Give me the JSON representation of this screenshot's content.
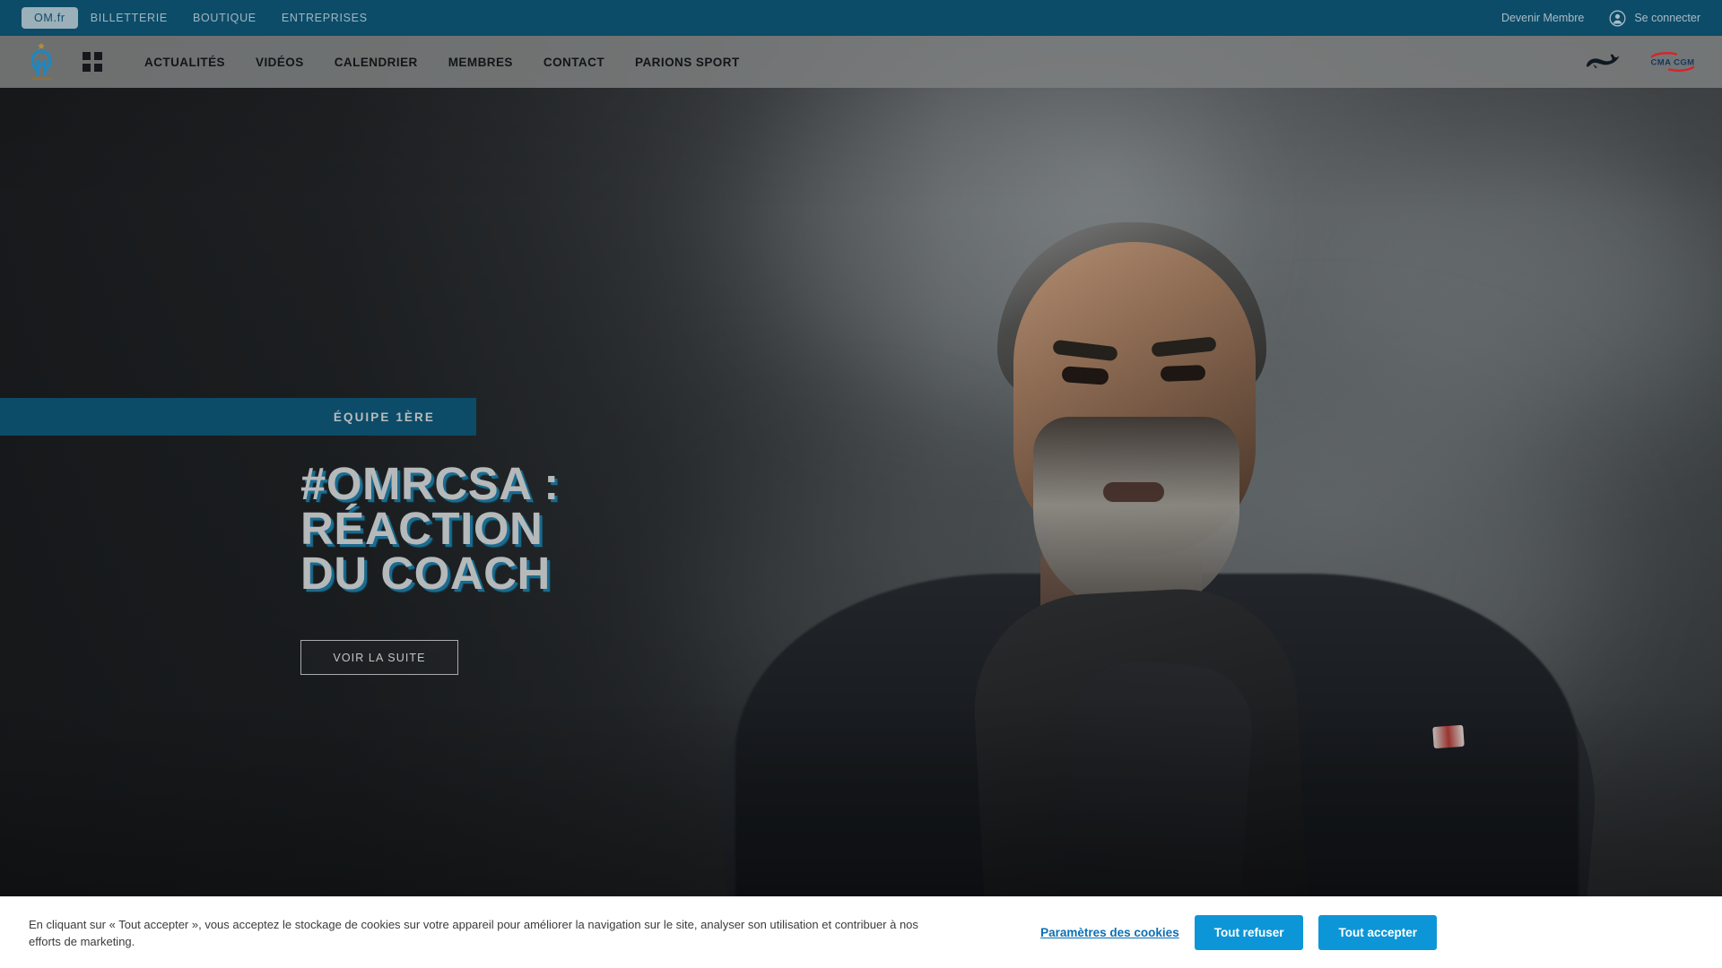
{
  "topbar": {
    "links": [
      {
        "label": "OM.fr",
        "active": true
      },
      {
        "label": "BILLETTERIE",
        "active": false
      },
      {
        "label": "BOUTIQUE",
        "active": false
      },
      {
        "label": "ENTREPRISES",
        "active": false
      }
    ],
    "member_label": "Devenir Membre",
    "signin_label": "Se connecter",
    "signin_icon": "user-avatar-icon",
    "background_color": "#0d4c68"
  },
  "mainnav": {
    "logo_alt": "Olympique de Marseille",
    "grid_icon": "grid-menu-icon",
    "items": [
      {
        "label": "ACTUALITÉS"
      },
      {
        "label": "VIDÉOS"
      },
      {
        "label": "CALENDRIER"
      },
      {
        "label": "MEMBRES"
      },
      {
        "label": "CONTACT"
      },
      {
        "label": "PARIONS SPORT"
      }
    ],
    "sponsors": [
      {
        "name": "puma-logo"
      },
      {
        "name": "cma-cgm-logo",
        "label": "CMA CGM"
      }
    ],
    "background_color": "#7d7f7f"
  },
  "hero": {
    "category": "ÉQUIPE 1ÈRE",
    "title_line1": "#OMRCSA :",
    "title_line2": "RÉACTION",
    "title_line3": "DU COACH",
    "cta_label": "VOIR LA SUITE",
    "badge_color": "#0c4c68",
    "title_shadow_color": "#1a6b8f",
    "image_alt": "Coach on the sideline"
  },
  "cookie_banner": {
    "text": "En cliquant sur « Tout accepter », vous acceptez le stockage de cookies sur votre appareil pour améliorer la navigation sur le site, analyser son utilisation et contribuer à nos efforts de marketing.",
    "settings_label": "Paramètres des cookies",
    "reject_label": "Tout refuser",
    "accept_label": "Tout accepter",
    "button_color": "#0c96d8",
    "link_color": "#0b6fb5"
  }
}
